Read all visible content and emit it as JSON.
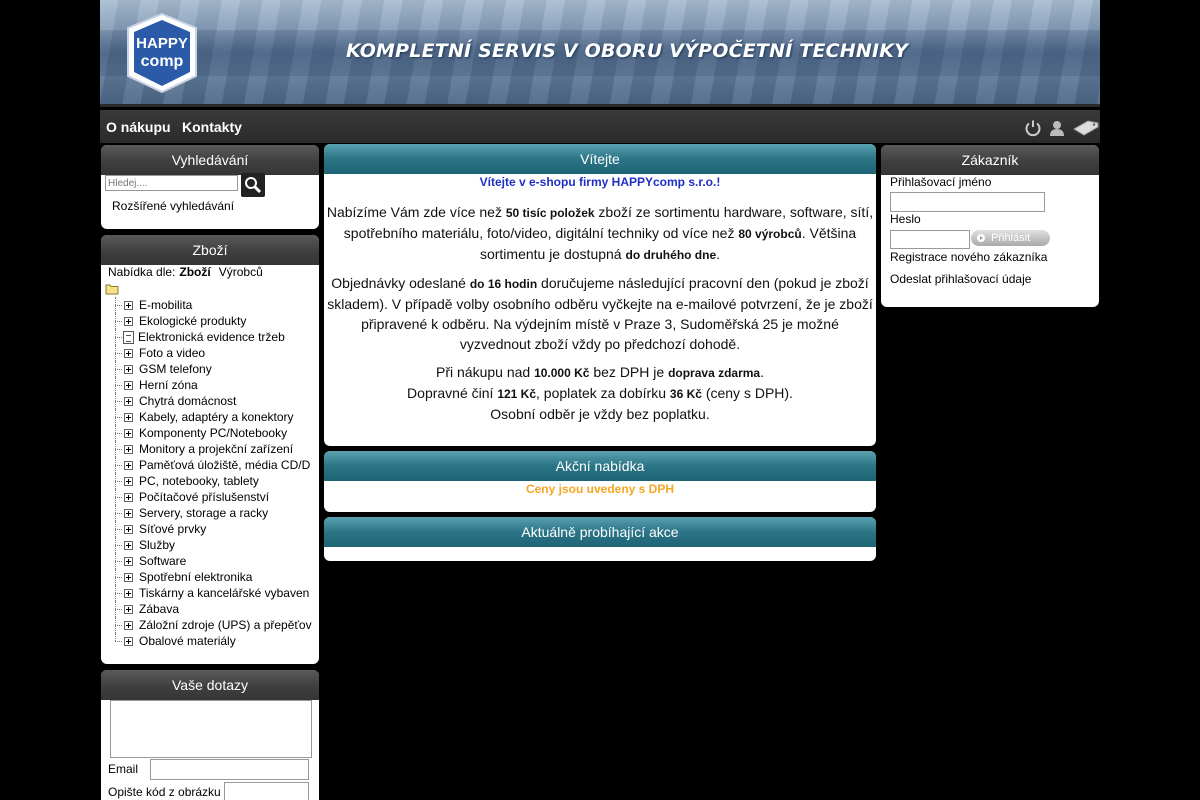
{
  "banner": {
    "logo_line1": "HAPPY",
    "logo_line2": "comp",
    "slogan": "KOMPLETNÍ SERVIS V OBORU VÝPOČETNÍ TECHNIKY"
  },
  "nav": {
    "items": [
      "O nákupu",
      "Kontakty"
    ],
    "icons": [
      "power-icon",
      "user-icon",
      "price-tag-icon"
    ]
  },
  "search": {
    "title": "Vyhledávání",
    "placeholder": "Hledej....",
    "advanced": "Rozšířené vyhledávání"
  },
  "goods": {
    "title": "Zboží",
    "sort_label": "Nabídka dle:",
    "sort_selected": "Zboží",
    "sort_other": "Výrobců",
    "categories": [
      "E-mobilita",
      "Ekologické produkty",
      "Elektronická evidence tržeb",
      "Foto a video",
      "GSM telefony",
      "Herní zóna",
      "Chytrá domácnost",
      "Kabely, adaptéry a konektory",
      "Komponenty PC/Notebooky",
      "Monitory a projekční zařízení",
      "Paměťová úložiště, média CD/D",
      "PC, notebooky, tablety",
      "Počítačové příslušenství",
      "Servery, storage a racky",
      "Síťové prvky",
      "Služby",
      "Software",
      "Spotřební elektronika",
      "Tiskárny a kancelářské vybaven",
      "Zábava",
      "Záložní zdroje (UPS) a přepěťov",
      "Obalové materiály"
    ]
  },
  "questions": {
    "title": "Vaše dotazy",
    "email_label": "Email",
    "code_label": "Opište kód z obrázku"
  },
  "welcome": {
    "title": "Vítejte",
    "greeting": "Vítejte v e-shopu firmy HAPPYcomp s.r.o.!",
    "p1": {
      "a": "Nabízíme Vám zde více než ",
      "b": "50 tisíc položek",
      "c": " zboží ze sortimentu hardware, software, sítí, spotřebního materiálu, foto/video, digitální techniky od více než ",
      "d": "80 výrobců",
      "e": ". Většina sortimentu je dostupná ",
      "f": "do druhého dne",
      "g": "."
    },
    "p2": {
      "a": "Objednávky odeslané ",
      "b": "do 16 hodin",
      "c": " doručujeme následující pracovní den (pokud je zboží skladem). V případě volby osobního odběru vyčkejte na e-mailové potvrzení, že je zboží připravené k odběru. Na výdejním místě v Praze 3, Sudoměřská 25 je možné vyzvednout zboží vždy po předchozí dohodě."
    },
    "p3": {
      "a": "Při nákupu nad ",
      "b": "10.000 Kč",
      "c": " bez DPH je ",
      "d": "doprava zdarma",
      "e": ".",
      "f": "Dopravné činí ",
      "g": "121 Kč",
      "h": ", poplatek za dobírku ",
      "i": "36 Kč",
      "j": " (ceny s DPH).",
      "k": "Osobní odběr je vždy bez poplatku."
    }
  },
  "offer": {
    "title": "Akční nabídka",
    "note": "Ceny jsou uvedeny s DPH"
  },
  "actions": {
    "title": "Aktuálně probíhající akce"
  },
  "customer": {
    "title": "Zákazník",
    "login_label": "Přihlašovací jméno",
    "password_label": "Heslo",
    "login_button": "Přihlásit",
    "register": "Registrace nového zákazníka",
    "send_credentials": "Odeslat přihlašovací údaje"
  }
}
